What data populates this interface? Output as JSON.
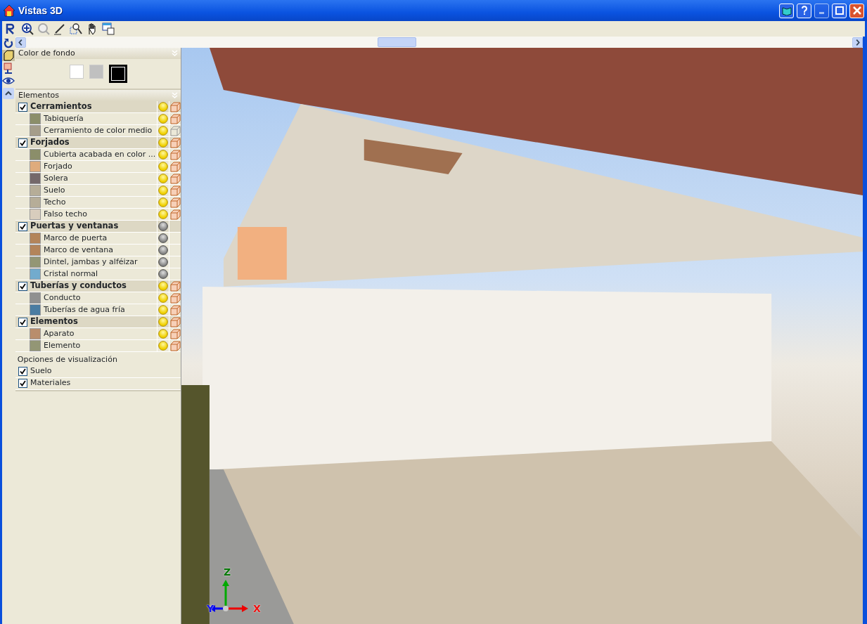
{
  "window": {
    "title": "Vistas 3D"
  },
  "background_panel": {
    "title": "Color de fondo",
    "swatches": [
      {
        "color": "#ffffff",
        "selected": false
      },
      {
        "color": "#c0c0c0",
        "selected": false
      },
      {
        "color": "#000000",
        "selected": true
      }
    ]
  },
  "elements_panel": {
    "title": "Elementos",
    "groups": [
      {
        "label": "Cerramientos",
        "checked": true,
        "light": true,
        "solid": true,
        "wireframe": false,
        "children": [
          {
            "label": "Tabiquería",
            "color": "#8b8e6a",
            "light": true,
            "solid": true,
            "wireframe": false
          },
          {
            "label": "Cerramiento de color medio",
            "color": "#a59d8a",
            "light": true,
            "solid": false,
            "wireframe": true
          }
        ]
      },
      {
        "label": "Forjados",
        "checked": true,
        "light": true,
        "solid": true,
        "wireframe": false,
        "children": [
          {
            "label": "Cubierta acabada en color ...",
            "color": "#8b8e6a",
            "light": true,
            "solid": true,
            "wireframe": false
          },
          {
            "label": "Forjado",
            "color": "#dfab7c",
            "light": true,
            "solid": true,
            "wireframe": false
          },
          {
            "label": "Solera",
            "color": "#74686a",
            "light": true,
            "solid": true,
            "wireframe": false
          },
          {
            "label": "Suelo",
            "color": "#b6ad98",
            "light": true,
            "solid": true,
            "wireframe": false
          },
          {
            "label": "Techo",
            "color": "#b6ad98",
            "light": true,
            "solid": true,
            "wireframe": false
          },
          {
            "label": "Falso techo",
            "color": "#d8cdbd",
            "light": true,
            "solid": true,
            "wireframe": false
          }
        ]
      },
      {
        "label": "Puertas y ventanas",
        "checked": true,
        "light": false,
        "solid": false,
        "wireframe": false,
        "children": [
          {
            "label": "Marco de puerta",
            "color": "#b3845a",
            "light": false,
            "solid": false,
            "wireframe": false
          },
          {
            "label": "Marco de ventana",
            "color": "#b3845a",
            "light": false,
            "solid": false,
            "wireframe": false
          },
          {
            "label": "Dintel, jambas y alféizar",
            "color": "#939675",
            "light": false,
            "solid": false,
            "wireframe": false
          },
          {
            "label": "Cristal normal",
            "color": "#72abcd",
            "light": false,
            "solid": false,
            "wireframe": false
          }
        ]
      },
      {
        "label": "Tuberías y conductos",
        "checked": true,
        "light": true,
        "solid": true,
        "wireframe": false,
        "children": [
          {
            "label": "Conducto",
            "color": "#909090",
            "light": true,
            "solid": true,
            "wireframe": false
          },
          {
            "label": "Tuberías de agua fría",
            "color": "#4a7ca2",
            "light": true,
            "solid": true,
            "wireframe": false
          }
        ]
      },
      {
        "label": "Elementos",
        "checked": true,
        "light": true,
        "solid": true,
        "wireframe": false,
        "children": [
          {
            "label": "Aparato",
            "color": "#b98d6c",
            "light": true,
            "solid": true,
            "wireframe": false
          },
          {
            "label": "Elemento",
            "color": "#939675",
            "light": true,
            "solid": true,
            "wireframe": false
          }
        ]
      }
    ]
  },
  "view_options": {
    "title": "Opciones de visualización",
    "options": [
      {
        "label": "Suelo",
        "checked": true
      },
      {
        "label": "Materiales",
        "checked": true
      }
    ]
  },
  "axes": {
    "x": "X",
    "y": "Y",
    "z": "Z"
  }
}
